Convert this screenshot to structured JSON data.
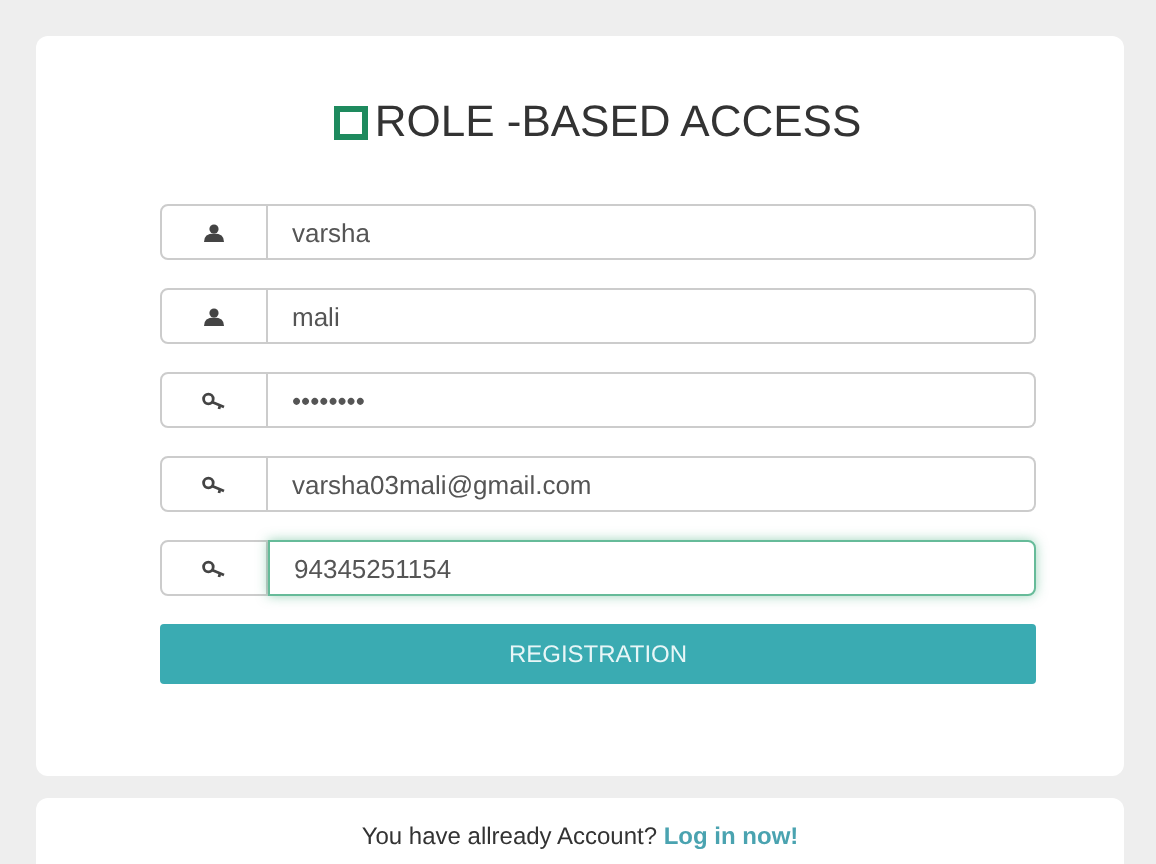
{
  "title": "ROLE -BASED ACCESS",
  "fields": [
    {
      "kind": "user",
      "value": "varsha",
      "focused": false
    },
    {
      "kind": "user",
      "value": "mali",
      "focused": false
    },
    {
      "kind": "key",
      "value": "••••••••",
      "focused": false
    },
    {
      "kind": "key",
      "value": "varsha03mali@gmail.com",
      "focused": false
    },
    {
      "kind": "key",
      "value": "94345251154",
      "focused": true
    }
  ],
  "submit_button": "REGISTRATION",
  "footer": {
    "prompt": "You have allready Account?",
    "link": "Log in now!"
  }
}
